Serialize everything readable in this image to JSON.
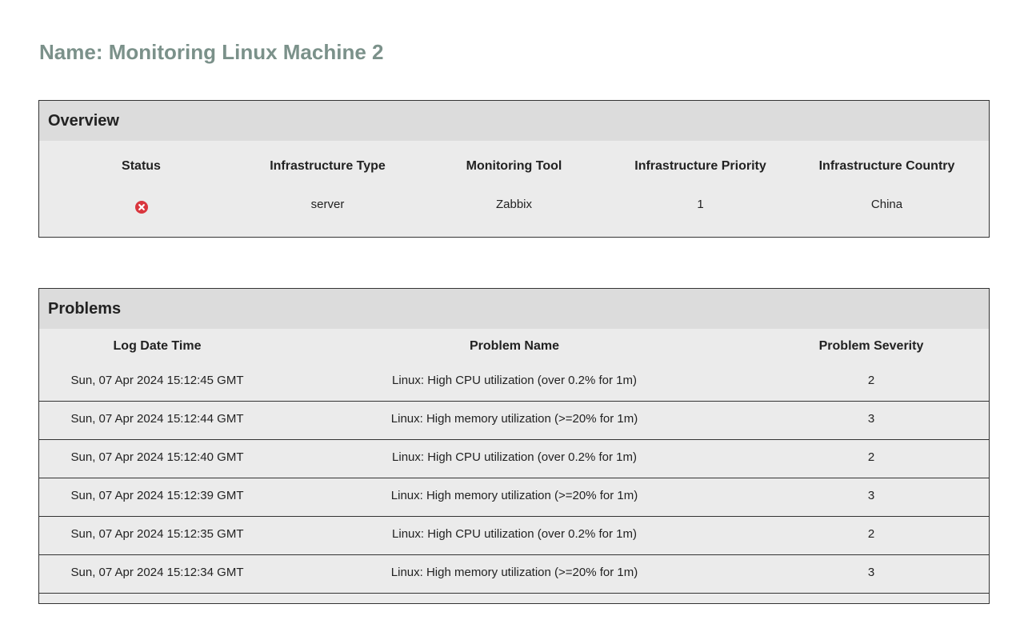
{
  "page": {
    "title": "Name: Monitoring Linux Machine 2"
  },
  "overview": {
    "heading": "Overview",
    "columns": [
      "Status",
      "Infrastructure Type",
      "Monitoring Tool",
      "Infrastructure Priority",
      "Infrastructure Country"
    ],
    "values": {
      "status_icon": "error-x-circle-icon",
      "infrastructure_type": "server",
      "monitoring_tool": "Zabbix",
      "infrastructure_priority": "1",
      "infrastructure_country": "China"
    }
  },
  "problems": {
    "heading": "Problems",
    "columns": [
      "Log Date Time",
      "Problem Name",
      "Problem Severity"
    ],
    "rows": [
      {
        "log_date_time": "Sun, 07 Apr 2024 15:12:45 GMT",
        "problem_name": "Linux: High CPU utilization (over 0.2% for 1m)",
        "severity": "2"
      },
      {
        "log_date_time": "Sun, 07 Apr 2024 15:12:44 GMT",
        "problem_name": "Linux: High memory utilization (>=20% for 1m)",
        "severity": "3"
      },
      {
        "log_date_time": "Sun, 07 Apr 2024 15:12:40 GMT",
        "problem_name": "Linux: High CPU utilization (over 0.2% for 1m)",
        "severity": "2"
      },
      {
        "log_date_time": "Sun, 07 Apr 2024 15:12:39 GMT",
        "problem_name": "Linux: High memory utilization (>=20% for 1m)",
        "severity": "3"
      },
      {
        "log_date_time": "Sun, 07 Apr 2024 15:12:35 GMT",
        "problem_name": "Linux: High CPU utilization (over 0.2% for 1m)",
        "severity": "2"
      },
      {
        "log_date_time": "Sun, 07 Apr 2024 15:12:34 GMT",
        "problem_name": "Linux: High memory utilization (>=20% for 1m)",
        "severity": "3"
      }
    ]
  },
  "colors": {
    "title": "#7b918a",
    "status_error": "#d9363e",
    "panel_header_bg": "#dcdcdc",
    "panel_bg": "#ebebeb"
  }
}
